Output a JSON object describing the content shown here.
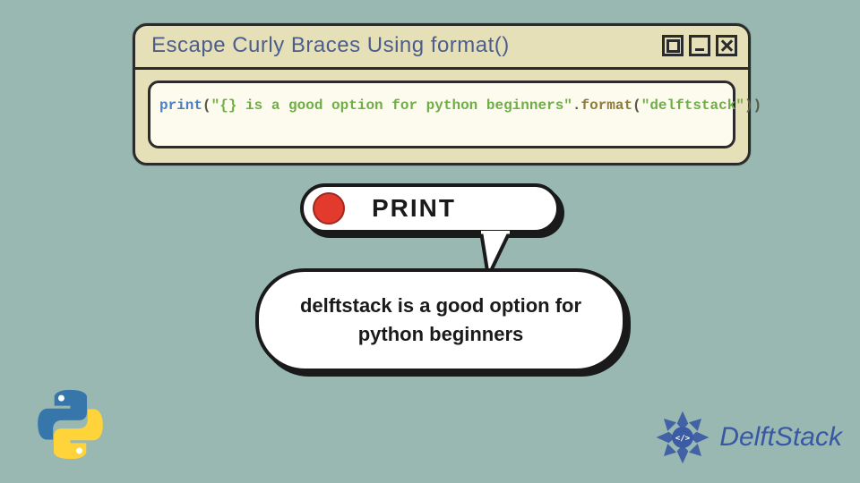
{
  "window": {
    "title": "Escape Curly Braces Using format()"
  },
  "code": {
    "kw": "print",
    "open": "(",
    "str1": "\"{} is a good option for python beginners\"",
    "dot": ".",
    "meth": "format",
    "open2": "(",
    "str2": "\"delftstack\"",
    "close": "))"
  },
  "print_button": {
    "label": "PRINT"
  },
  "output_text": "delftstack is a good option for python beginners",
  "brand": {
    "name": "DelftStack"
  }
}
